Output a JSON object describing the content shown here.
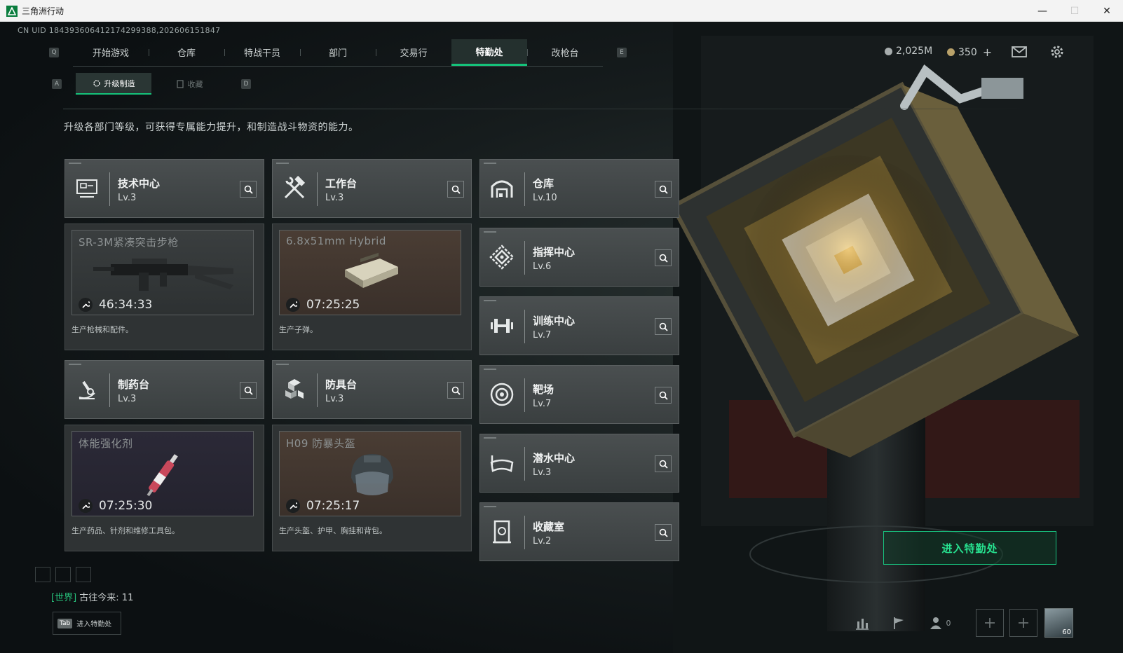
{
  "window": {
    "title": "三角洲行动",
    "minimize": "—",
    "maximize": "☐",
    "close": "✕"
  },
  "uid": "CN UID 1843936064121742993​88,202606151847",
  "nav": {
    "left_key": "Q",
    "right_key": "E",
    "tabs": [
      "开始游戏",
      "仓库",
      "特战干员",
      "部门",
      "交易行",
      "特勤处",
      "改枪台"
    ],
    "active_tab": "特勤处"
  },
  "currency": {
    "balance_1": "2,025M",
    "balance_2": "350",
    "add": "+"
  },
  "subnav": {
    "left_key": "A",
    "right_key": "D",
    "tabs": [
      "升级制造",
      "收藏"
    ]
  },
  "description": "升级各部门等级，可获得专属能力提升，和制造战斗物资的能力。",
  "facilities": {
    "tech_center": {
      "name": "技术中心",
      "level": "Lv.3"
    },
    "workbench": {
      "name": "工作台",
      "level": "Lv.3"
    },
    "storage": {
      "name": "仓库",
      "level": "Lv.10"
    },
    "command_center": {
      "name": "指挥中心",
      "level": "Lv.6"
    },
    "training_center": {
      "name": "训练中心",
      "level": "Lv.7"
    },
    "pharmacy": {
      "name": "制药台",
      "level": "Lv.3"
    },
    "armor_bench": {
      "name": "防具台",
      "level": "Lv.3"
    },
    "shooting_range": {
      "name": "靶场",
      "level": "Lv.7"
    },
    "diving_center": {
      "name": "潜水中心",
      "level": "Lv.3"
    },
    "collection_room": {
      "name": "收藏室",
      "level": "Lv.2"
    }
  },
  "production": {
    "tech_center": {
      "item": "SR-3M紧凑突击步枪",
      "timer": "46:34:33",
      "desc": "生产枪械和配件。"
    },
    "workbench": {
      "item": "6.8x51mm Hybrid",
      "timer": "07:25:25",
      "desc": "生产子弹。"
    },
    "pharmacy": {
      "item": "体能强化剂",
      "timer": "07:25:30",
      "desc": "生产药品、针剂和维修工具包。"
    },
    "armor_bench": {
      "item": "H09 防暴头盔",
      "timer": "07:25:17",
      "desc": "生产头盔、护甲、胸挂和背包。"
    }
  },
  "enter_button": "进入特勤处",
  "chat": {
    "channel": "[世界]",
    "message": "古往今来: 11"
  },
  "tab_hint": {
    "key": "Tab",
    "label": "进入特勤处"
  },
  "friends_count": "0",
  "avatar_level": "60",
  "colors": {
    "accent": "#15c27a",
    "card": "#43484a",
    "background": "#0d1113"
  }
}
